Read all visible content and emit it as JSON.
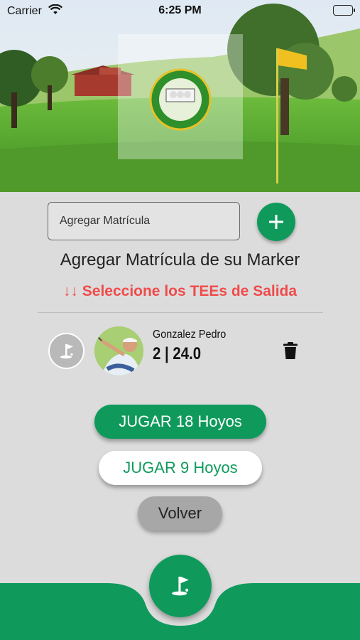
{
  "status_bar": {
    "carrier": "Carrier",
    "time": "6:25 PM",
    "wifi_icon": "wifi-icon",
    "battery_icon": "battery-icon"
  },
  "hero": {
    "logo_alt": "club-logo"
  },
  "marker_input": {
    "placeholder": "Agregar Matrícula",
    "value": ""
  },
  "add_button": {
    "icon": "plus-icon",
    "label": "+"
  },
  "marker_title": "Agregar Matrícula de su Marker",
  "tee_warning": "↓↓ Seleccione los TEEs de Salida",
  "player": {
    "name": "Gonzalez Pedro",
    "stats": "2 | 24.0",
    "tee_icon": "golf-flag-icon",
    "delete_icon": "trash-icon"
  },
  "buttons": {
    "play18": "JUGAR 18 Hoyos",
    "play9": "JUGAR 9 Hoyos",
    "back": "Volver"
  },
  "bottom_nav": {
    "home_icon": "golf-flag-icon"
  },
  "colors": {
    "primary": "#0f9a5c",
    "warning": "#f04b4b",
    "background": "#dcdcdc"
  }
}
